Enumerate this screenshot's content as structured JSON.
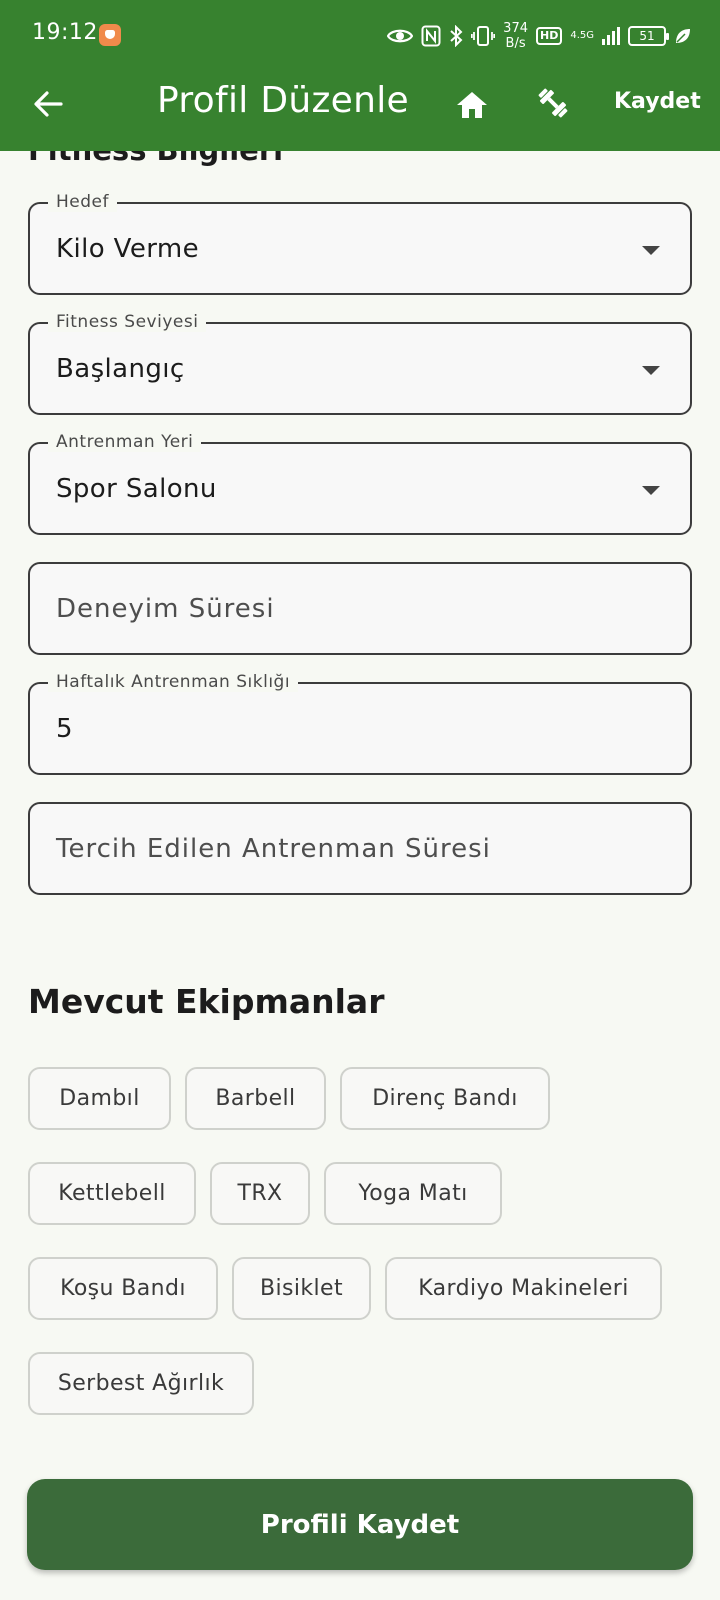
{
  "status_bar": {
    "time": "19:12",
    "net_speed_value": "374",
    "net_speed_unit": "B/s",
    "hd_label": "HD",
    "network_label": "4.5G",
    "battery_level": "51"
  },
  "app_bar": {
    "title": "Profil Düzenle",
    "save_label": "Kaydet"
  },
  "section": {
    "fitness_title": "Fitness Bilgileri"
  },
  "form": {
    "goal": {
      "label": "Hedef",
      "value": "Kilo Verme"
    },
    "fitness_level": {
      "label": "Fitness Seviyesi",
      "value": "Başlangıç"
    },
    "workout_place": {
      "label": "Antrenman Yeri",
      "value": "Spor Salonu"
    },
    "experience": {
      "placeholder": "Deneyim Süresi"
    },
    "weekly_frequency": {
      "label": "Haftalık Antrenman Sıklığı",
      "value": "5"
    },
    "preferred_duration": {
      "placeholder": "Tercih Edilen Antrenman Süresi"
    }
  },
  "equipment": {
    "title": "Mevcut Ekipmanlar",
    "items": [
      "Dambıl",
      "Barbell",
      "Direnç Bandı",
      "Kettlebell",
      "TRX",
      "Yoga Matı",
      "Koşu Bandı",
      "Bisiklet",
      "Kardiyo Makineleri",
      "Serbest Ağırlık"
    ]
  },
  "actions": {
    "save_profile": "Profili Kaydet"
  },
  "colors": {
    "primary": "#37822f",
    "button": "#3b6b3a",
    "background": "#f7f9f3"
  }
}
